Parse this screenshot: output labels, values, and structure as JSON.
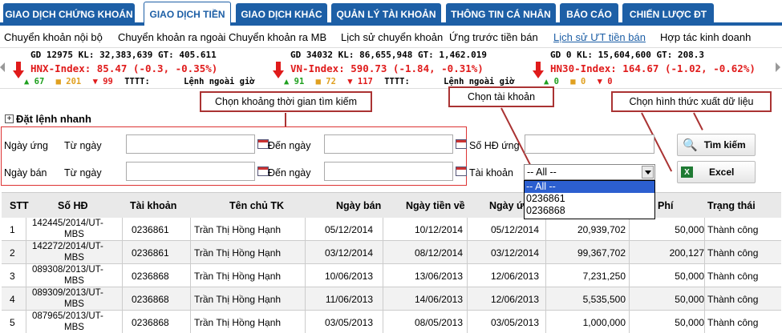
{
  "tabs": [
    {
      "label": "GIAO DỊCH CHỨNG KHOÁN",
      "active": false
    },
    {
      "label": "GIAO DỊCH TIỀN",
      "active": true
    },
    {
      "label": "GIAO DỊCH KHÁC",
      "active": false
    },
    {
      "label": "QUẢN LÝ TÀI KHOẢN",
      "active": false
    },
    {
      "label": "THÔNG TIN CÁ NHÂN",
      "active": false
    },
    {
      "label": "BÁO CÁO",
      "active": false
    },
    {
      "label": "CHIẾN LƯỢC ĐT",
      "active": false
    }
  ],
  "submenu": [
    {
      "label": "Chuyển khoản nội bộ"
    },
    {
      "label": "Chuyển khoản ra ngoài"
    },
    {
      "label": "Chuyển khoản ra MB"
    },
    {
      "label": "Lịch sử chuyển khoản"
    },
    {
      "label": "Ứng trước tiền bán"
    },
    {
      "label": "Lịch sử ƯT tiền bán"
    },
    {
      "label": "Hợp tác kinh doanh"
    }
  ],
  "ticker": [
    {
      "l1": "GD      12975   KL:   32,383,639  GT:    405.611",
      "index": "HNX-Index:  85.47 (-0.3, -0.35%)",
      "up": "▲ 67",
      "ref": "■ 201",
      "down": "▼ 99",
      "tttt": "TTTT:",
      "note": "Lệnh ngoài giờ"
    },
    {
      "l1": "GD      34032   KL:   86,655,948  GT:  1,462.019",
      "index": "VN-Index:  590.73 (-1.84, -0.31%)",
      "up": "▲ 91",
      "ref": "■ 72",
      "down": "▼ 117",
      "tttt": "TTTT:",
      "note": "Lệnh ngoài giờ"
    },
    {
      "l1": "GD       0      KL:   15,604,600  GT:    208.3",
      "index": "HN30-Index:  164.67 (-1.02, -0.62%)",
      "up": "▲ 0",
      "ref": "■ 0",
      "down": "▼ 0",
      "tttt": "",
      "note": ""
    }
  ],
  "callouts": {
    "time": "Chọn khoảng thời gian tìm kiếm",
    "account": "Chọn  tài khoản",
    "export": "Chọn hình thức xuất dữ liệu"
  },
  "form": {
    "quick_order": "Đặt lệnh nhanh",
    "ngay_ung": "Ngày ứng",
    "ngay_ban": "Ngày bán",
    "tu_ngay": "Từ ngày",
    "den_ngay": "Đến ngày",
    "so_hd_ung": "Số HĐ ứng",
    "tai_khoan": "Tài khoản",
    "account_selected": "-- All --",
    "account_options": [
      "-- All --",
      "0236861",
      "0236868"
    ],
    "search_button": "Tìm kiếm",
    "excel_button": "Excel"
  },
  "table": {
    "headers": [
      "STT",
      "Số HĐ",
      "Tài khoản",
      "Tên chủ TK",
      "Ngày bán",
      "Ngày tiền về",
      "Ngày ứ",
      "Phí",
      "Trạng thái"
    ],
    "rows": [
      {
        "stt": "1",
        "hd1": "142445/2014/UT-",
        "hd2": "MBS",
        "tk": "0236861",
        "ten": "Trần Thị Hồng Hạnh",
        "ban": "05/12/2014",
        "ve": "10/12/2014",
        "ung": "05/12/2014",
        "tien": "20,939,702",
        "phi": "50,000",
        "tt": "Thành công"
      },
      {
        "stt": "2",
        "hd1": "142272/2014/UT-",
        "hd2": "MBS",
        "tk": "0236861",
        "ten": "Trần Thị Hồng Hạnh",
        "ban": "03/12/2014",
        "ve": "08/12/2014",
        "ung": "03/12/2014",
        "tien": "99,367,702",
        "phi": "200,127",
        "tt": "Thành công"
      },
      {
        "stt": "3",
        "hd1": "089308/2013/UT-",
        "hd2": "MBS",
        "tk": "0236868",
        "ten": "Trần Thị Hồng Hạnh",
        "ban": "10/06/2013",
        "ve": "13/06/2013",
        "ung": "12/06/2013",
        "tien": "7,231,250",
        "phi": "50,000",
        "tt": "Thành công"
      },
      {
        "stt": "4",
        "hd1": "089309/2013/UT-",
        "hd2": "MBS",
        "tk": "0236868",
        "ten": "Trần Thị Hồng Hạnh",
        "ban": "11/06/2013",
        "ve": "14/06/2013",
        "ung": "12/06/2013",
        "tien": "5,535,500",
        "phi": "50,000",
        "tt": "Thành công"
      },
      {
        "stt": "5",
        "hd1": "087965/2013/UT-",
        "hd2": "MBS",
        "tk": "0236868",
        "ten": "Trần Thị Hồng Hạnh",
        "ban": "03/05/2013",
        "ve": "08/05/2013",
        "ung": "03/05/2013",
        "tien": "1,000,000",
        "phi": "50,000",
        "tt": "Thành công"
      }
    ]
  }
}
